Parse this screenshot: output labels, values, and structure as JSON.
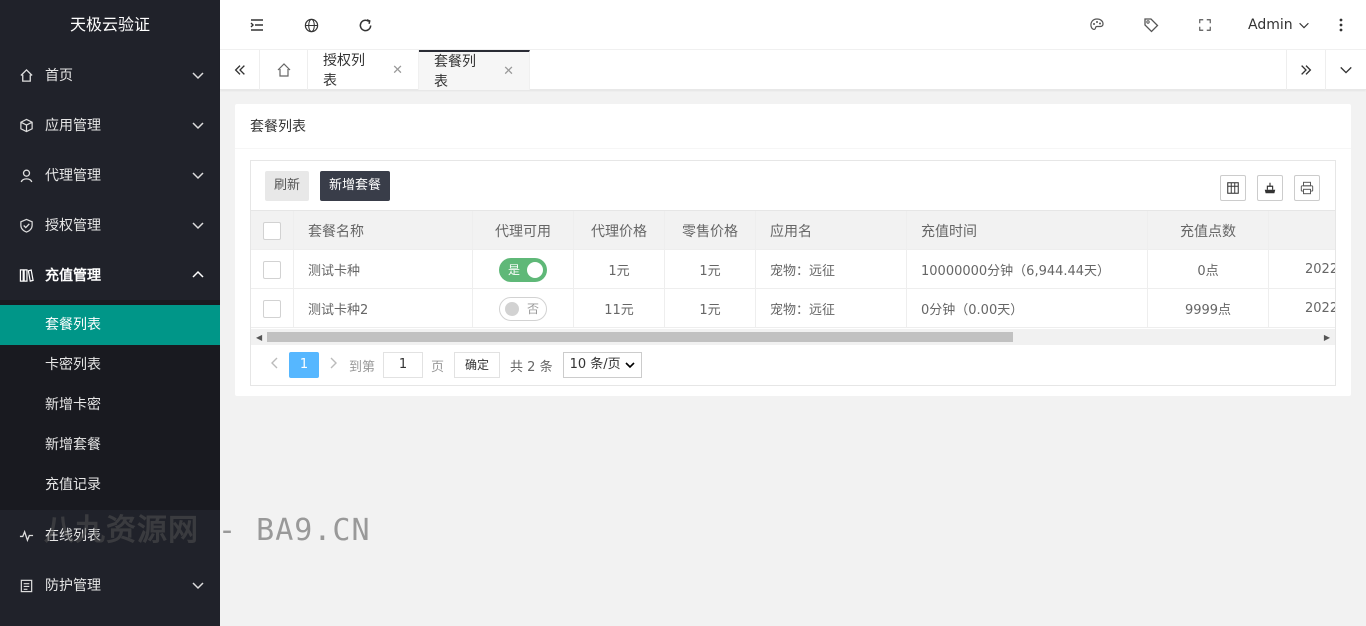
{
  "app": {
    "brand": "天极云验证"
  },
  "sidebar": {
    "items": [
      {
        "label": "首页",
        "icon": "home-icon"
      },
      {
        "label": "应用管理",
        "icon": "cube-icon"
      },
      {
        "label": "代理管理",
        "icon": "user-icon"
      },
      {
        "label": "授权管理",
        "icon": "shield-check-icon"
      },
      {
        "label": "充值管理",
        "icon": "books-icon"
      },
      {
        "label": "在线列表",
        "icon": "pulse-icon"
      },
      {
        "label": "防护管理",
        "icon": "clipboard-icon"
      }
    ],
    "submenu": [
      {
        "label": "套餐列表",
        "active": true
      },
      {
        "label": "卡密列表"
      },
      {
        "label": "新增卡密"
      },
      {
        "label": "新增套餐"
      },
      {
        "label": "充值记录"
      }
    ]
  },
  "header": {
    "user": "Admin"
  },
  "tabs": [
    {
      "label": "授权列表"
    },
    {
      "label": "套餐列表",
      "active": true
    }
  ],
  "card": {
    "title": "套餐列表"
  },
  "toolbar": {
    "refresh_label": "刷新",
    "add_label": "新增套餐"
  },
  "table": {
    "columns": [
      "套餐名称",
      "代理可用",
      "代理价格",
      "零售价格",
      "应用名",
      "充值时间",
      "充值点数"
    ],
    "rows": [
      {
        "name": "测试卡种",
        "agent": "是",
        "agent_on": true,
        "agent_price": "1元",
        "retail_price": "1元",
        "app": "宠物：远征",
        "time": "10000000分钟（6,944.44天）",
        "points": "0点",
        "extra": "2022"
      },
      {
        "name": "测试卡种2",
        "agent": "否",
        "agent_on": false,
        "agent_price": "11元",
        "retail_price": "1元",
        "app": "宠物：远征",
        "time": "0分钟（0.00天）",
        "points": "9999点",
        "extra": "2022"
      }
    ]
  },
  "pager": {
    "current": "1",
    "goto_label": "到第",
    "goto_value": "1",
    "page_label": "页",
    "ok_label": "确定",
    "total": "共 2 条",
    "page_size": "10 条/页"
  },
  "watermark": {
    "text_cn": "八九资源网",
    "text_en": " - BA9.CN"
  },
  "colors": {
    "sidebar": "#20222a",
    "active": "#009688",
    "switch_on": "#5fb878",
    "dark_button": "#393d49"
  }
}
